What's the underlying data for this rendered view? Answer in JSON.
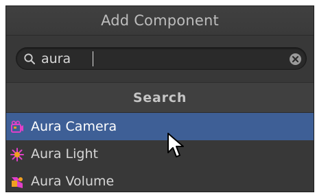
{
  "window": {
    "title": "Add Component"
  },
  "search": {
    "value": "aura",
    "icon": "search-icon",
    "clear_icon": "clear-icon"
  },
  "section": {
    "header": "Search"
  },
  "results": [
    {
      "label": "Aura Camera",
      "icon": "camera-icon",
      "selected": true
    },
    {
      "label": "Aura Light",
      "icon": "light-icon",
      "selected": false
    },
    {
      "label": "Aura Volume",
      "icon": "volume-icon",
      "selected": false
    }
  ],
  "colors": {
    "selection": "#3e5f96",
    "panel": "#383838",
    "icon_magenta": "#e040c8",
    "icon_orange": "#f0a020"
  }
}
